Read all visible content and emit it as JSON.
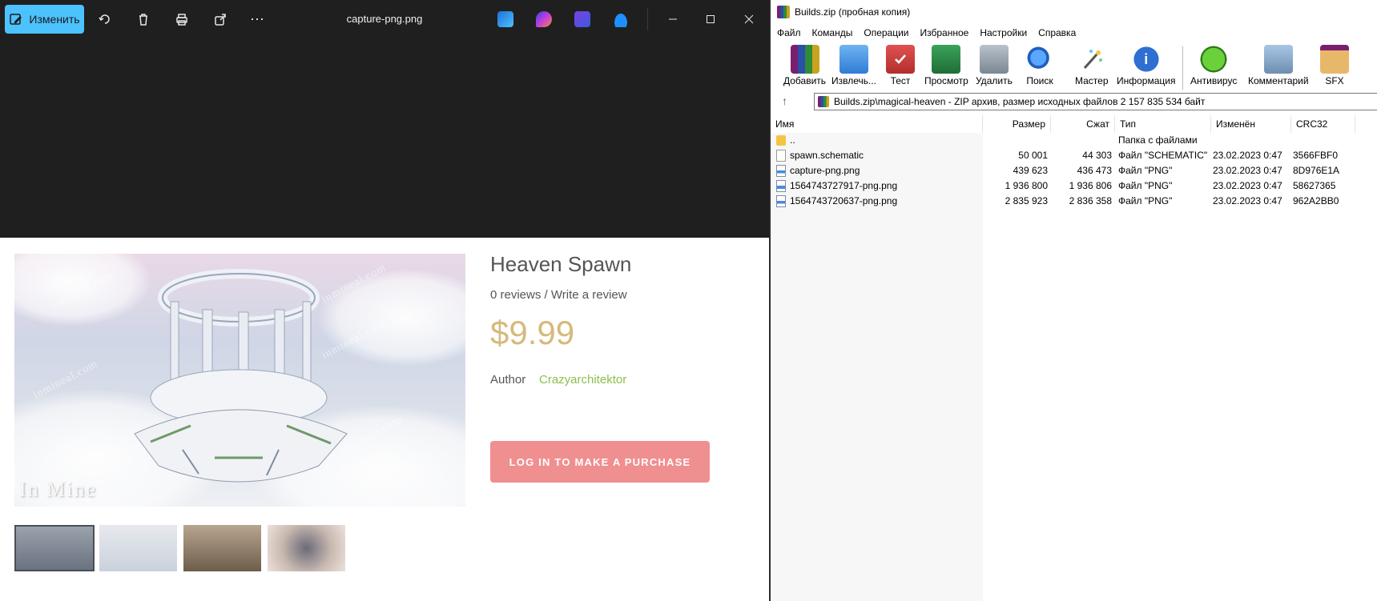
{
  "viewer": {
    "edit_label": "Изменить",
    "file_title": "capture-png.png",
    "product": {
      "title": "Heaven Spawn",
      "reviews": "0 reviews / Write a review",
      "price": "$9.99",
      "author_label": "Author",
      "author_name": "Crazyarchitektor",
      "buy_label": "LOG IN TO MAKE A PURCHASE",
      "watermark": "inmineal.com",
      "logo_text": "In Mine"
    }
  },
  "winrar": {
    "title": "Builds.zip (пробная копия)",
    "menu": [
      "Файл",
      "Команды",
      "Операции",
      "Избранное",
      "Настройки",
      "Справка"
    ],
    "toolbar": [
      "Добавить",
      "Извлечь...",
      "Тест",
      "Просмотр",
      "Удалить",
      "Поиск",
      "Мастер",
      "Информация",
      "Антивирус",
      "Комментарий",
      "SFX"
    ],
    "address": "Builds.zip\\magical-heaven - ZIP архив, размер исходных файлов 2 157 835 534 байт",
    "columns": [
      "Имя",
      "Размер",
      "Сжат",
      "Тип",
      "Изменён",
      "CRC32"
    ],
    "rows": [
      {
        "name": "..",
        "size": "",
        "packed": "",
        "type": "Папка с файлами",
        "modified": "",
        "crc": "",
        "icon": "folder-icon"
      },
      {
        "name": "spawn.schematic",
        "size": "50 001",
        "packed": "44 303",
        "type": "Файл \"SCHEMATIC\"",
        "modified": "23.02.2023 0:47",
        "crc": "3566FBF0",
        "icon": "file-icon"
      },
      {
        "name": "capture-png.png",
        "size": "439 623",
        "packed": "436 473",
        "type": "Файл \"PNG\"",
        "modified": "23.02.2023 0:47",
        "crc": "8D976E1A",
        "icon": "image-file-icon"
      },
      {
        "name": "1564743727917-png.png",
        "size": "1 936 800",
        "packed": "1 936 806",
        "type": "Файл \"PNG\"",
        "modified": "23.02.2023 0:47",
        "crc": "58627365",
        "icon": "image-file-icon"
      },
      {
        "name": "1564743720637-png.png",
        "size": "2 835 923",
        "packed": "2 836 358",
        "type": "Файл \"PNG\"",
        "modified": "23.02.2023 0:47",
        "crc": "962A2BB0",
        "icon": "image-file-icon"
      }
    ]
  },
  "colors": {
    "accent": "#4cc2ff",
    "price": "#d7b97c",
    "author": "#8cc04b",
    "buy_button": "#f08f8f"
  }
}
